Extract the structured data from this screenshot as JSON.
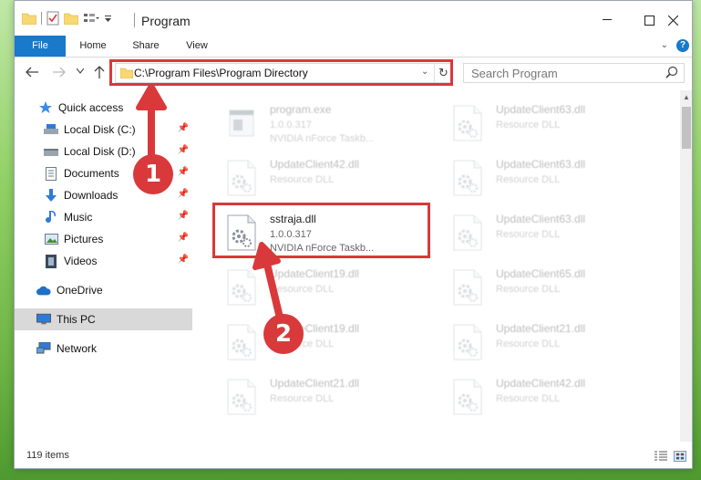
{
  "window": {
    "title": "Program"
  },
  "ribbon": {
    "tabs": [
      {
        "label": "File"
      },
      {
        "label": "Home"
      },
      {
        "label": "Share"
      },
      {
        "label": "View"
      }
    ]
  },
  "navbar": {
    "address": "C:\\Program Files\\Program Directory",
    "search_placeholder": "Search Program"
  },
  "sidebar": {
    "quick_access": "Quick access",
    "items": [
      {
        "label": "Local Disk (C:)",
        "icon": "drive-icon",
        "pinned": true
      },
      {
        "label": "Local Disk (D:)",
        "icon": "drive-icon",
        "pinned": true
      },
      {
        "label": "Documents",
        "icon": "documents-icon",
        "pinned": true
      },
      {
        "label": "Downloads",
        "icon": "downloads-icon",
        "pinned": true
      },
      {
        "label": "Music",
        "icon": "music-icon",
        "pinned": true
      },
      {
        "label": "Pictures",
        "icon": "pictures-icon",
        "pinned": true
      },
      {
        "label": "Videos",
        "icon": "videos-icon",
        "pinned": true
      }
    ],
    "onedrive": "OneDrive",
    "this_pc": "This PC",
    "network": "Network"
  },
  "files": [
    {
      "name": "program.exe",
      "line2": "1.0.0.317",
      "line3": "NVIDIA nForce Taskb...",
      "type": "exe",
      "faded": true
    },
    {
      "name": "UpdateClient63.dll",
      "line2": "Resource DLL",
      "line3": "",
      "type": "dll",
      "faded": true
    },
    {
      "name": "UpdateClient42.dll",
      "line2": "Resource DLL",
      "line3": "",
      "type": "dll",
      "faded": true
    },
    {
      "name": "UpdateClient63.dll",
      "line2": "Resource DLL",
      "line3": "",
      "type": "dll",
      "faded": true
    },
    {
      "name": "sstraja.dll",
      "line2": "1.0.0.317",
      "line3": "NVIDIA nForce Taskb...",
      "type": "dll",
      "faded": false
    },
    {
      "name": "UpdateClient63.dll",
      "line2": "Resource DLL",
      "line3": "",
      "type": "dll",
      "faded": true
    },
    {
      "name": "UpdateClient19.dll",
      "line2": "Resource DLL",
      "line3": "",
      "type": "dll",
      "faded": true
    },
    {
      "name": "UpdateClient65.dll",
      "line2": "Resource DLL",
      "line3": "",
      "type": "dll",
      "faded": true
    },
    {
      "name": "UpdateClient19.dll",
      "line2": "Resource DLL",
      "line3": "",
      "type": "dll",
      "faded": true
    },
    {
      "name": "UpdateClient21.dll",
      "line2": "Resource DLL",
      "line3": "",
      "type": "dll",
      "faded": true
    },
    {
      "name": "UpdateClient21.dll",
      "line2": "Resource DLL",
      "line3": "",
      "type": "dll",
      "faded": true
    },
    {
      "name": "UpdateClient42.dll",
      "line2": "Resource DLL",
      "line3": "",
      "type": "dll",
      "faded": true
    }
  ],
  "status": {
    "count": "119 items"
  },
  "annotations": {
    "step1": "1",
    "step2": "2",
    "color": "#d9393b"
  },
  "colors": {
    "accent": "#1979ca",
    "selected_bg": "#d9d9d9"
  }
}
